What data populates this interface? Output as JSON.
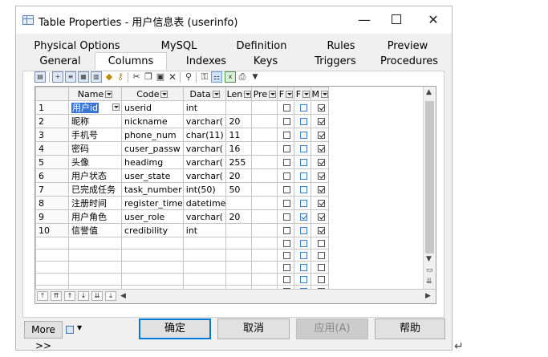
{
  "window": {
    "title": "Table Properties - 用户信息表 (userinfo)",
    "minimize_glyph": "—",
    "close_glyph": "✕"
  },
  "tabs_back": [
    "Physical Options",
    "MySQL",
    "Definition",
    "Rules",
    "Preview"
  ],
  "tabs_front": [
    "General",
    "Columns",
    "Indexes",
    "Keys",
    "Triggers",
    "Procedures"
  ],
  "active_tab": "Columns",
  "grid": {
    "headers": [
      "Name",
      "Code",
      "Data",
      "Len",
      "Pre",
      "F",
      "F",
      "M"
    ],
    "rows": [
      {
        "num": "1",
        "name": "用户id",
        "code": "userid",
        "data": "int",
        "len": "",
        "pre": "",
        "p": false,
        "f": false,
        "m": true
      },
      {
        "num": "2",
        "name": "昵称",
        "code": "nickname",
        "data": "varchar(",
        "len": "20",
        "pre": "",
        "p": false,
        "f": false,
        "m": true
      },
      {
        "num": "3",
        "name": "手机号",
        "code": "phone_num",
        "data": "char(11)",
        "len": "11",
        "pre": "",
        "p": false,
        "f": false,
        "m": true
      },
      {
        "num": "4",
        "name": "密码",
        "code": "cuser_passw",
        "data": "varchar(",
        "len": "16",
        "pre": "",
        "p": false,
        "f": false,
        "m": true
      },
      {
        "num": "5",
        "name": "头像",
        "code": "headimg",
        "data": "varchar(",
        "len": "255",
        "pre": "",
        "p": false,
        "f": false,
        "m": true
      },
      {
        "num": "6",
        "name": "用户状态",
        "code": "user_state",
        "data": "varchar(",
        "len": "20",
        "pre": "",
        "p": false,
        "f": false,
        "m": true
      },
      {
        "num": "7",
        "name": "已完成任务",
        "code": "task_number",
        "data": "int(50)",
        "len": "50",
        "pre": "",
        "p": false,
        "f": false,
        "m": true
      },
      {
        "num": "8",
        "name": "注册时间",
        "code": "register_time",
        "data": "datetime",
        "len": "",
        "pre": "",
        "p": false,
        "f": false,
        "m": true
      },
      {
        "num": "9",
        "name": "用户角色",
        "code": "user_role",
        "data": "varchar(",
        "len": "20",
        "pre": "",
        "p": false,
        "f": true,
        "m": true
      },
      {
        "num": "10",
        "name": "信誉值",
        "code": "credibility",
        "data": "int",
        "len": "",
        "pre": "",
        "p": false,
        "f": false,
        "m": true
      }
    ],
    "empty_rows": 6
  },
  "footer": {
    "more": "More >>",
    "ok": "确定",
    "cancel": "取消",
    "apply": "应用(A)",
    "help": "帮助"
  },
  "icons": [
    "table-icon",
    "properties-icon",
    "insert-row-icon",
    "add-row-icon",
    "copy-icon",
    "paste-icon",
    "cut-icon",
    "delete-icon",
    "find-icon",
    "filter-icon",
    "excel-icon",
    "print-icon"
  ]
}
